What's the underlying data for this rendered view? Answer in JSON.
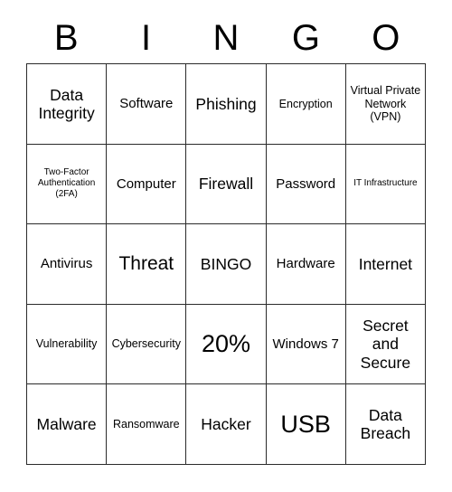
{
  "header": {
    "letters": [
      "B",
      "I",
      "N",
      "G",
      "O"
    ]
  },
  "grid": {
    "rows": 5,
    "columns": 5,
    "border_color": "#2b2b2b",
    "cell_background": "#ffffff",
    "text_color": "#000000",
    "cells": [
      [
        {
          "text": "Data Integrity",
          "size": "fs-l"
        },
        {
          "text": "Software",
          "size": "fs-m"
        },
        {
          "text": "Phishing",
          "size": "fs-l"
        },
        {
          "text": "Encryption",
          "size": "fs-s"
        },
        {
          "text": "Virtual Private Network (VPN)",
          "size": "fs-s"
        }
      ],
      [
        {
          "text": "Two-Factor Authentication (2FA)",
          "size": "fs-xs"
        },
        {
          "text": "Computer",
          "size": "fs-m"
        },
        {
          "text": "Firewall",
          "size": "fs-l"
        },
        {
          "text": "Password",
          "size": "fs-m"
        },
        {
          "text": "IT Infrastructure",
          "size": "fs-xs"
        }
      ],
      [
        {
          "text": "Antivirus",
          "size": "fs-m"
        },
        {
          "text": "Threat",
          "size": "fs-xl"
        },
        {
          "text": "BINGO",
          "size": "fs-l"
        },
        {
          "text": "Hardware",
          "size": "fs-m"
        },
        {
          "text": "Internet",
          "size": "fs-l"
        }
      ],
      [
        {
          "text": "Vulnerability",
          "size": "fs-s"
        },
        {
          "text": "Cybersecurity",
          "size": "fs-s"
        },
        {
          "text": "20%",
          "size": "fs-xxl"
        },
        {
          "text": "Windows 7",
          "size": "fs-m"
        },
        {
          "text": "Secret and Secure",
          "size": "fs-l"
        }
      ],
      [
        {
          "text": "Malware",
          "size": "fs-l"
        },
        {
          "text": "Ransomware",
          "size": "fs-s"
        },
        {
          "text": "Hacker",
          "size": "fs-l"
        },
        {
          "text": "USB",
          "size": "fs-xxl"
        },
        {
          "text": "Data Breach",
          "size": "fs-l"
        }
      ]
    ]
  }
}
